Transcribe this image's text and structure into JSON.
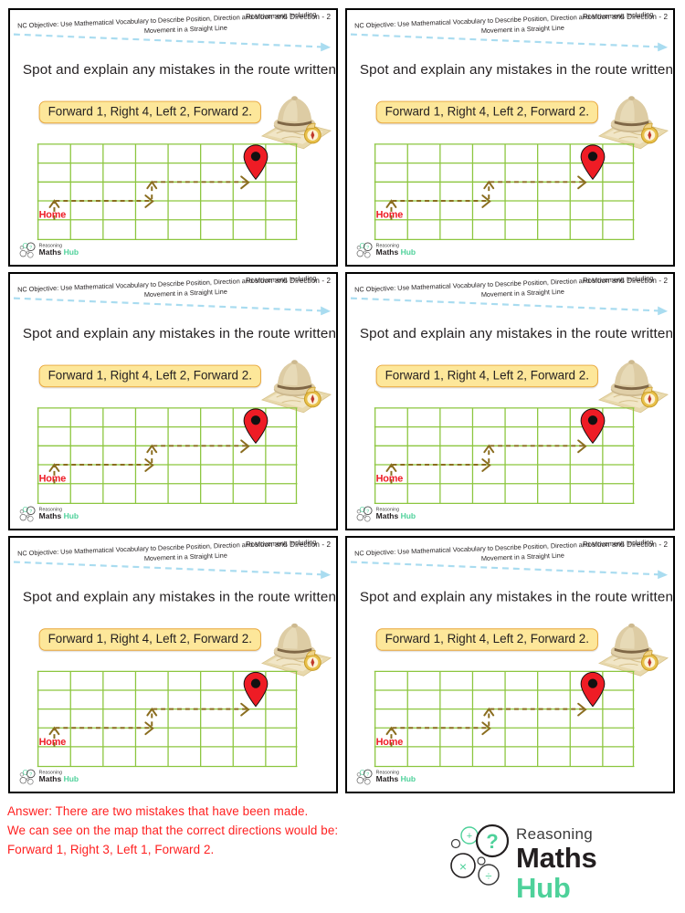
{
  "panel": {
    "header_right": "Position and Direction - 2",
    "nc_objective_line1": "NC Objective: Use Mathematical Vocabulary to  Describe Position, Direction and Movement, Including",
    "nc_objective_line2": "Movement in a Straight Line",
    "question": "Spot and explain any mistakes in the route written below.",
    "route_instruction": "Forward 1, Right 4, Left 2, Forward 2.",
    "home_label": "Home",
    "logo_word1": "Reasoning",
    "logo_word2": "Maths",
    "logo_word3": "Hub",
    "grid": {
      "columns": 8,
      "rows": 5,
      "line_color": "#8cc63f"
    },
    "pin_color": "#ee1c25",
    "route_color": "#8a6d1f",
    "banner_fill": "#fde79a",
    "banner_border": "#e8a53a"
  },
  "panels_count": 6,
  "answer": {
    "line1": "Answer: There are two mistakes that have been made.",
    "line2": " We can see on the map that the correct directions would be:",
    "line3": "Forward 1, Right 3, Left 1, Forward 2.",
    "color": "#ff2020"
  },
  "brand": {
    "word1": "Reasoning",
    "word2": "Maths",
    "word3": "Hub",
    "accent": "#4ed19a",
    "dark": "#231f20"
  },
  "icons": {
    "map_pin": "map-pin-icon",
    "explorer_hat": "explorer-hat-icon",
    "compass": "compass-icon",
    "arrow_right": "arrow-right-icon",
    "arrow_up": "arrow-up-icon"
  }
}
